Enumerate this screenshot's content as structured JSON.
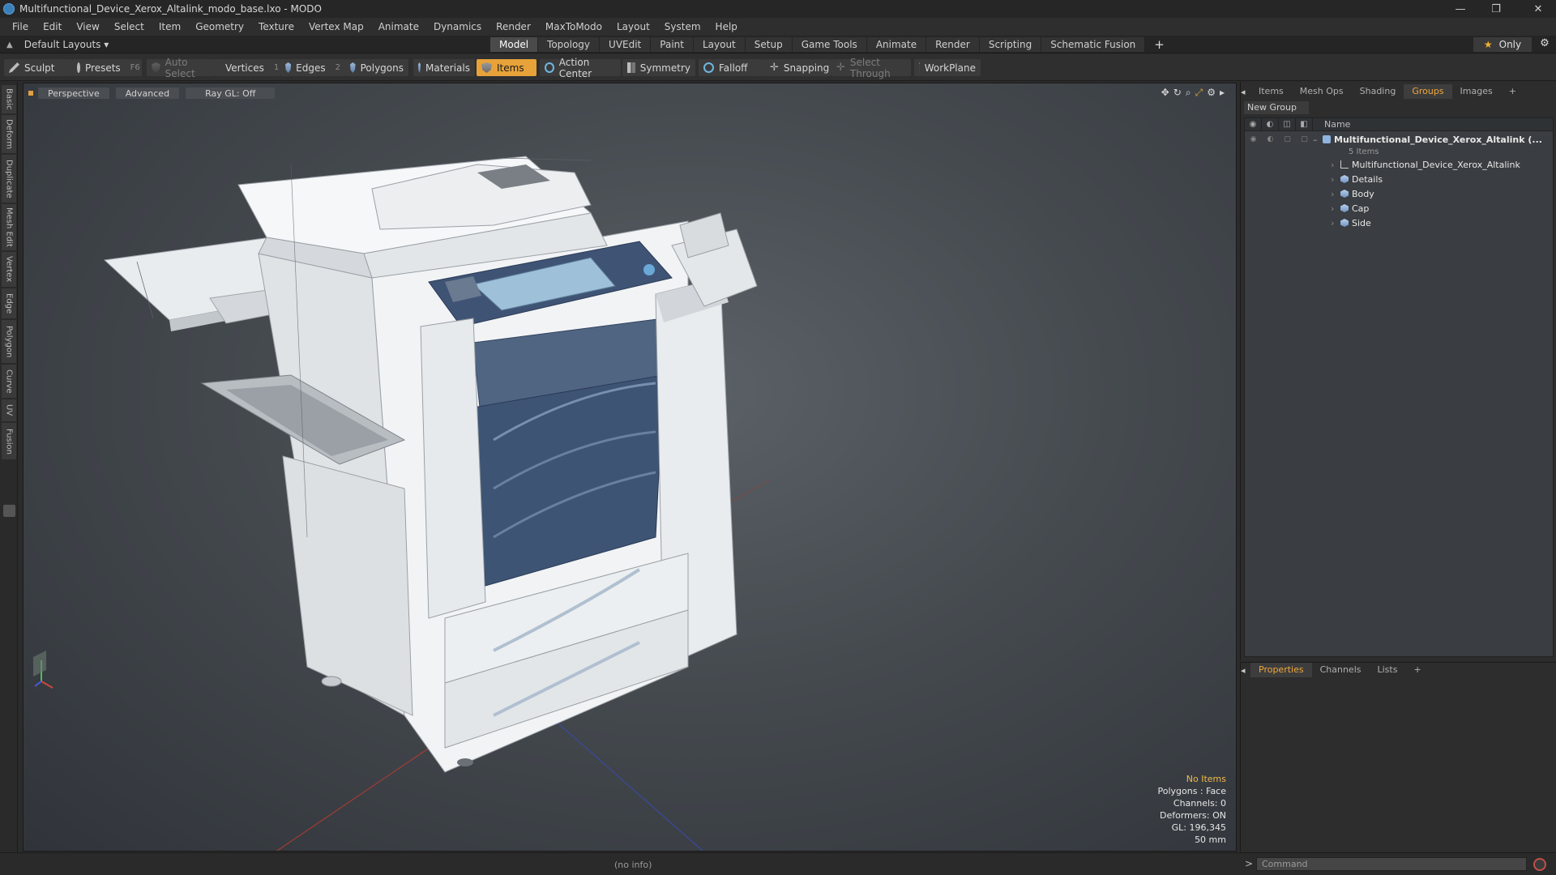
{
  "window": {
    "title": "Multifunctional_Device_Xerox_Altalink_modo_base.lxo - MODO",
    "minimize": "—",
    "maximize": "❐",
    "close": "✕"
  },
  "menu": [
    "File",
    "Edit",
    "View",
    "Select",
    "Item",
    "Geometry",
    "Texture",
    "Vertex Map",
    "Animate",
    "Dynamics",
    "Render",
    "MaxToModo",
    "Layout",
    "System",
    "Help"
  ],
  "layout": {
    "selector": "Default Layouts ▾",
    "tabs": [
      "Model",
      "Topology",
      "UVEdit",
      "Paint",
      "Layout",
      "Setup",
      "Game Tools",
      "Animate",
      "Render",
      "Scripting",
      "Schematic Fusion"
    ],
    "active_tab": "Model",
    "plus": "+",
    "only_label": "Only",
    "star": "★"
  },
  "toolbar": {
    "sculpt": "Sculpt",
    "presets": "Presets",
    "presets_key": "F6",
    "auto_select": "Auto Select",
    "vertices": "Vertices",
    "vertices_key": "1",
    "edges": "Edges",
    "edges_key": "2",
    "polygons": "Polygons",
    "materials": "Materials",
    "items": "Items",
    "action_center": "Action Center",
    "symmetry": "Symmetry",
    "falloff": "Falloff",
    "snapping": "Snapping",
    "select_through": "Select Through",
    "workplane": "WorkPlane"
  },
  "left_tabs": [
    "Basic",
    "Deform",
    "Duplicate",
    "Mesh Edit",
    "Vertex",
    "Edge",
    "Polygon",
    "Curve",
    "UV",
    "Fusion"
  ],
  "viewport": {
    "view_mode": "Perspective",
    "shading": "Advanced",
    "raygl": "Ray GL: Off",
    "info": {
      "selection": "No Items",
      "polygons": "Polygons : Face",
      "channels": "Channels: 0",
      "deformers": "Deformers: ON",
      "gl": "GL: 196,345",
      "scale": "50 mm"
    }
  },
  "right_panel": {
    "tabs": [
      "Items",
      "Mesh Ops",
      "Shading",
      "Groups",
      "Images"
    ],
    "active_tab": "Groups",
    "plus": "+",
    "new_group": "New Group",
    "column_name": "Name",
    "tree": {
      "root": "Multifunctional_Device_Xerox_Altalink (...",
      "root_sub": "5 Items",
      "children": [
        "Multifunctional_Device_Xerox_Altalink",
        "Details",
        "Body",
        "Cap",
        "Side"
      ]
    }
  },
  "properties_panel": {
    "tabs": [
      "Properties",
      "Channels",
      "Lists"
    ],
    "active_tab": "Properties",
    "plus": "+"
  },
  "status": {
    "info": "(no info)",
    "command_placeholder": "Command"
  }
}
